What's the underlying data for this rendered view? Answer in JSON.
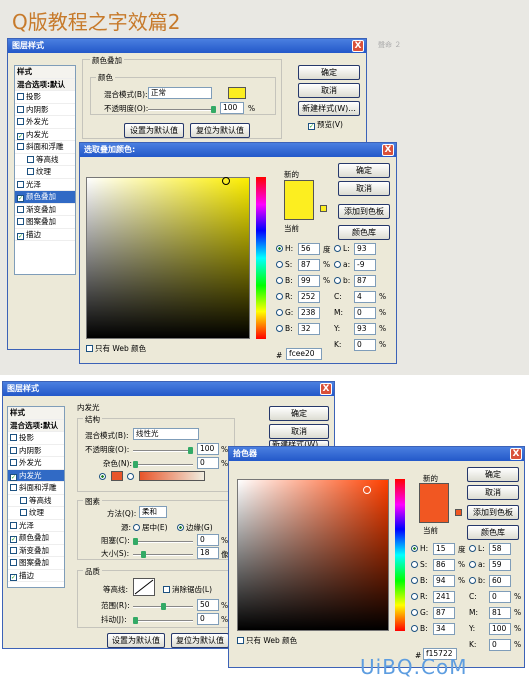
{
  "page_title": "Q版教程之字效篇2",
  "watermark": "UiBQ.CoM",
  "faint_text": "聲命 ２",
  "top_layer_style": {
    "title": "图层样式",
    "close": "X",
    "sidebar": [
      {
        "label": "样式",
        "checked": false,
        "kind": "hdr"
      },
      {
        "label": "混合选项:默认",
        "checked": false,
        "kind": "hdr"
      },
      {
        "label": "投影",
        "checked": false
      },
      {
        "label": "内阴影",
        "checked": false
      },
      {
        "label": "外发光",
        "checked": false
      },
      {
        "label": "内发光",
        "checked": true
      },
      {
        "label": "斜面和浮雕",
        "checked": false
      },
      {
        "label": "等高线",
        "checked": false,
        "indent": true
      },
      {
        "label": "纹理",
        "checked": false,
        "indent": true
      },
      {
        "label": "光泽",
        "checked": false
      },
      {
        "label": "颜色叠加",
        "checked": true,
        "selected": true
      },
      {
        "label": "渐变叠加",
        "checked": false
      },
      {
        "label": "图案叠加",
        "checked": false
      },
      {
        "label": "描边",
        "checked": true
      }
    ],
    "group_title": "颜色叠加",
    "subgroup_title": "颜色",
    "blend_label": "混合模式(B):",
    "blend_value": "正常",
    "opacity_label": "不透明度(O):",
    "opacity_value": "100",
    "percent": "%",
    "reset_default": "设置为默认值",
    "restore_default": "复位为默认值",
    "ok": "确定",
    "cancel": "取消",
    "new_style": "新建样式(W)...",
    "preview": "预览(V)"
  },
  "top_picker": {
    "title": "选取叠加颜色:",
    "close": "X",
    "new_label": "新的",
    "current_label": "当前",
    "ok": "确定",
    "cancel": "取消",
    "add_swatch": "添加到色板",
    "libraries": "颜色库",
    "web_only": "只有 Web 颜色",
    "new_color": "#fcee20",
    "current_color": "#fcee20",
    "field_hue_color": "#fcee00",
    "fields": [
      {
        "l": "H:",
        "v": "56",
        "u": "度",
        "r": "L:",
        "rv": "93"
      },
      {
        "l": "S:",
        "v": "87",
        "u": "%",
        "r": "a:",
        "rv": "-9"
      },
      {
        "l": "B:",
        "v": "99",
        "u": "%",
        "r": "b:",
        "rv": "87"
      },
      {
        "l": "R:",
        "v": "252",
        "u": "",
        "r": "C:",
        "rv": "4",
        "ru": "%"
      },
      {
        "l": "G:",
        "v": "238",
        "u": "",
        "r": "M:",
        "rv": "0",
        "ru": "%"
      },
      {
        "l": "B:",
        "v": "32",
        "u": "",
        "r": "Y:",
        "rv": "93",
        "ru": "%"
      },
      {
        "l": "",
        "v": "",
        "u": "",
        "r": "K:",
        "rv": "0",
        "ru": "%"
      }
    ],
    "hex_label": "#",
    "hex_value": "fcee20"
  },
  "bottom_layer_style": {
    "title": "图层样式",
    "close": "X",
    "sidebar": [
      {
        "label": "样式",
        "checked": false,
        "kind": "hdr"
      },
      {
        "label": "混合选项:默认",
        "checked": false,
        "kind": "hdr"
      },
      {
        "label": "投影",
        "checked": false
      },
      {
        "label": "内阴影",
        "checked": false
      },
      {
        "label": "外发光",
        "checked": false
      },
      {
        "label": "内发光",
        "checked": true,
        "selected": true
      },
      {
        "label": "斜面和浮雕",
        "checked": false
      },
      {
        "label": "等高线",
        "checked": false,
        "indent": true
      },
      {
        "label": "纹理",
        "checked": false,
        "indent": true
      },
      {
        "label": "光泽",
        "checked": false
      },
      {
        "label": "颜色叠加",
        "checked": true
      },
      {
        "label": "渐变叠加",
        "checked": false
      },
      {
        "label": "图案叠加",
        "checked": false
      },
      {
        "label": "描边",
        "checked": true
      }
    ],
    "group_title": "内发光",
    "structure": "结构",
    "blend_label": "混合模式(B):",
    "blend_value": "线性光",
    "opacity_label": "不透明度(O):",
    "opacity_value": "100",
    "noise_label": "杂色(N):",
    "noise_value": "0",
    "elements": "图素",
    "method_label": "方法(Q):",
    "method_value": "柔和",
    "source_label": "源:",
    "center": "居中(E)",
    "edge": "边缘(G)",
    "choke_label": "阻塞(C):",
    "choke_value": "0",
    "size_label": "大小(S):",
    "size_value": "18",
    "size_unit": "像",
    "quality": "品质",
    "contour_label": "等高线:",
    "antialias": "消除锯齿(L)",
    "range_label": "范围(R):",
    "range_value": "50",
    "jitter_label": "抖动(J):",
    "jitter_value": "0",
    "percent": "%",
    "reset_default": "设置为默认值",
    "restore_default": "复位为默认值",
    "ok": "确定",
    "cancel": "取消",
    "new_style": "新建样式(W)...",
    "glow_color": "#e8552a"
  },
  "bottom_picker": {
    "title": "拾色器",
    "close": "X",
    "new_label": "新的",
    "current_label": "当前",
    "ok": "确定",
    "cancel": "取消",
    "add_swatch": "添加到色板",
    "libraries": "颜色库",
    "web_only": "只有 Web 颜色",
    "new_color": "#f15722",
    "current_color": "#f15722",
    "field_hue_color": "#ff4000",
    "fields": [
      {
        "l": "H:",
        "v": "15",
        "u": "度",
        "r": "L:",
        "rv": "58"
      },
      {
        "l": "S:",
        "v": "86",
        "u": "%",
        "r": "a:",
        "rv": "59"
      },
      {
        "l": "B:",
        "v": "94",
        "u": "%",
        "r": "b:",
        "rv": "60"
      },
      {
        "l": "R:",
        "v": "241",
        "u": "",
        "r": "C:",
        "rv": "0",
        "ru": "%"
      },
      {
        "l": "G:",
        "v": "87",
        "u": "",
        "r": "M:",
        "rv": "81",
        "ru": "%"
      },
      {
        "l": "B:",
        "v": "34",
        "u": "",
        "r": "Y:",
        "rv": "100",
        "ru": "%"
      },
      {
        "l": "",
        "v": "",
        "u": "",
        "r": "K:",
        "rv": "0",
        "ru": "%"
      }
    ],
    "hex_label": "#",
    "hex_value": "f15722"
  }
}
